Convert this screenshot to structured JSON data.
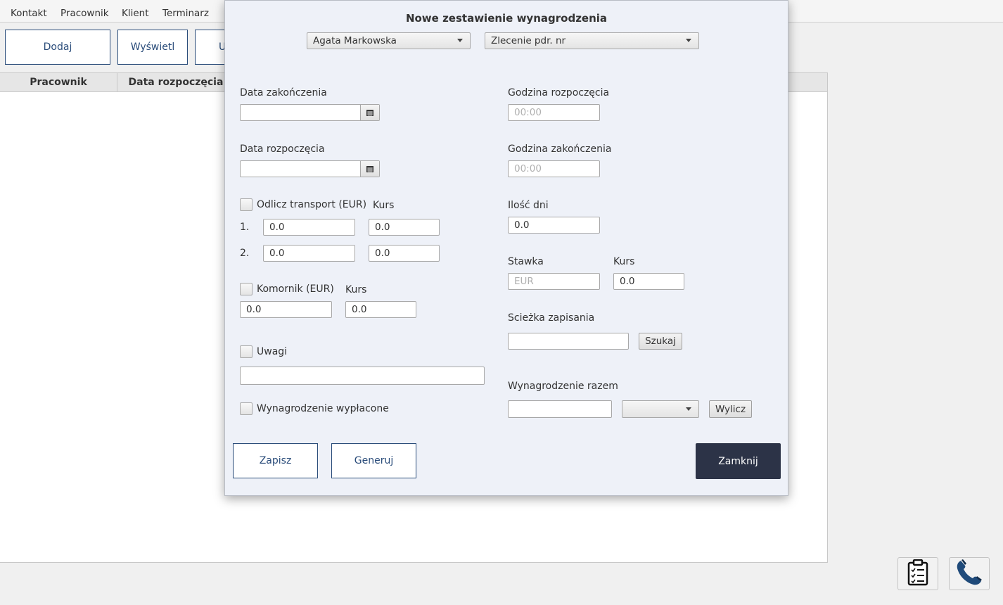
{
  "menu": [
    "Kontakt",
    "Pracownik",
    "Klient",
    "Terminarz"
  ],
  "toolbar": {
    "add": "Dodaj",
    "view": "Wyświetl",
    "partial": "U"
  },
  "table": {
    "columns": [
      "Pracownik",
      "Data rozpoczęcia"
    ]
  },
  "icons": {
    "clipboard": "clipboard-icon",
    "phone": "phone-icon"
  },
  "dialog": {
    "title": "Nowe zestawienie wynagrodzenia",
    "employee_select": "Agata Markowska",
    "order_select": "Zlecenie pdr. nr",
    "end_date_label": "Data zakończenia",
    "end_date_value": "",
    "start_date_label": "Data rozpoczęcia",
    "start_date_value": "",
    "start_time_label": "Godzina rozpoczęcia",
    "start_time_placeholder": "00:00",
    "end_time_label": "Godzina zakończenia",
    "end_time_placeholder": "00:00",
    "transport_label": "Odlicz transport (EUR)",
    "transport_rate_label": "Kurs",
    "transport_rows": [
      {
        "num": "1.",
        "value": "0.0",
        "rate": "0.0"
      },
      {
        "num": "2.",
        "value": "0.0",
        "rate": "0.0"
      }
    ],
    "days_label": "Ilość dni",
    "days_value": "0.0",
    "bailiff_label": "Komornik (EUR)",
    "bailiff_rate_label": "Kurs",
    "bailiff_value": "0.0",
    "bailiff_rate": "0.0",
    "rate_label": "Stawka",
    "rate_placeholder": "EUR",
    "rate_kurs_label": "Kurs",
    "rate_kurs_value": "0.0",
    "path_label": "Scieżka zapisania",
    "path_value": "",
    "search_button": "Szukaj",
    "notes_label": "Uwagi",
    "notes_value": "",
    "total_label": "Wynagrodzenie razem",
    "total_value": "",
    "total_currency": "",
    "calc_button": "Wylicz",
    "paid_label": "Wynagrodzenie wypłacone",
    "save_button": "Zapisz",
    "generate_button": "Generuj",
    "close_button": "Zamknij"
  }
}
